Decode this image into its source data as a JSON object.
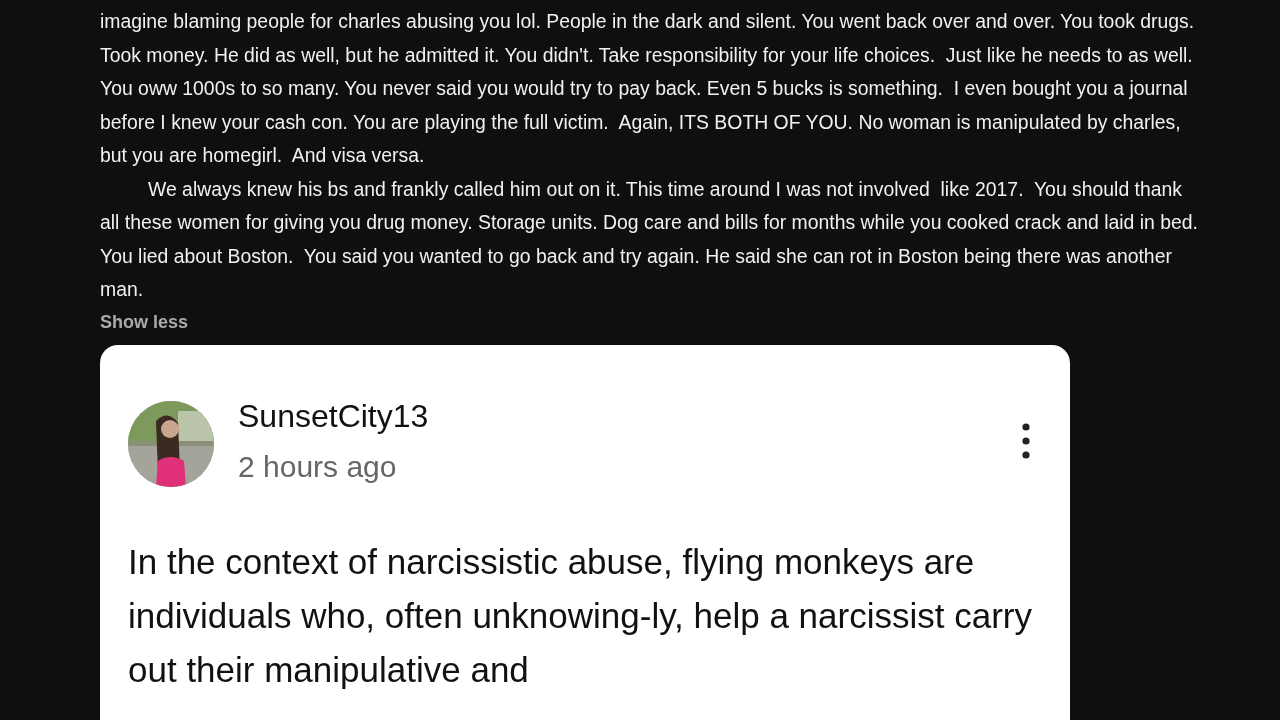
{
  "comment": {
    "paragraphs": [
      {
        "indented": false,
        "text": "imagine blaming people for charles abusing you lol. People in the dark and silent. You went back over and over. You took drugs. Took money. He did as well, but he admitted it. You didn't. Take responsibility for your life choices.  Just like he needs to as well. You oww 1000s to so many. You never said you would try to pay back. Even 5 bucks is something.  I even bought you a journal before I knew your cash con. You are playing the full victim.  Again, ITS BOTH OF YOU. No woman is manipulated by charles, but you are homegirl.  And visa versa."
      },
      {
        "indented": true,
        "text": "We always knew his bs and frankly called him out on it. This time around I was not involved  like 2017.  You should thank all these women for giving you drug money. Storage units. Dog care and bills for months while you cooked crack and laid in bed. You lied about Boston.  You said you wanted to go back and try again. He said she can rot in Boston being there was another man."
      }
    ],
    "toggle": "Show less"
  },
  "embedded_comment": {
    "author": "SunsetCity13",
    "time": "2 hours ago",
    "body": "In the context of narcissistic abuse, flying monkeys are individuals who, often unknowing-ly, help a narcissist carry out their manipulative and"
  }
}
